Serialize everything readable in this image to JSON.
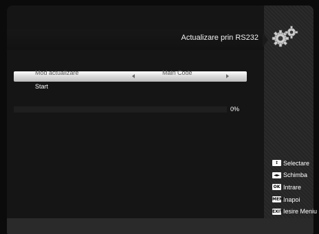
{
  "header": {
    "title": "Actualizare prin RS232",
    "icon": "gears-icon"
  },
  "menu": {
    "selected": {
      "label": "Mod actualizare",
      "value": "Main Code"
    },
    "start_label": "Start"
  },
  "progress": {
    "percent": 0,
    "label": "0%"
  },
  "legend": [
    {
      "key": "↕",
      "icon": "up-down-key-icon",
      "label": "Selectare"
    },
    {
      "key": "◄►",
      "icon": "left-right-key-icon",
      "label": "Schimba"
    },
    {
      "key": "OK",
      "icon": "ok-key-icon",
      "label": "Intrare"
    },
    {
      "key": "MENU",
      "icon": "menu-key-icon",
      "label": "Inapoi"
    },
    {
      "key": "EXIT",
      "icon": "exit-key-icon",
      "label": "Iesire Meniu"
    }
  ],
  "colors": {
    "background": "#0b0b0b",
    "panel": "#151515",
    "highlight": "#f2f2f2",
    "text": "#ffffff"
  }
}
